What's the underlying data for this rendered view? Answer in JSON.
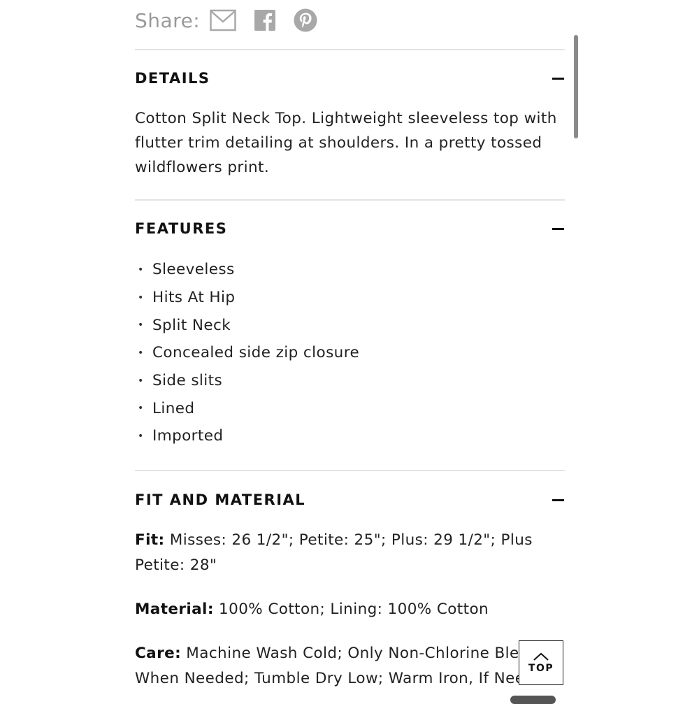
{
  "share": {
    "label": "Share:",
    "icons": [
      "email-icon",
      "facebook-icon",
      "pinterest-icon"
    ]
  },
  "details": {
    "title": "DETAILS",
    "text": "Cotton Split Neck Top. Lightweight sleeveless top with flutter trim detailing at shoulders. In a pretty tossed wildflowers print."
  },
  "features": {
    "title": "FEATURES",
    "items": [
      "Sleeveless",
      "Hits At Hip",
      "Split Neck",
      "Concealed side zip closure",
      "Side slits",
      "Lined",
      "Imported"
    ]
  },
  "fit_material": {
    "title": "FIT AND MATERIAL",
    "fit_label": "Fit:",
    "fit_value": " Misses: 26 1/2\"; Petite: 25\"; Plus: 29 1/2\"; Plus Petite: 28\"",
    "material_label": "Material:",
    "material_value": " 100% Cotton; Lining: 100% Cotton",
    "care_label": "Care:",
    "care_value": " Machine Wash Cold; Only Non-Chlorine Bleach When Needed; Tumble Dry Low; Warm Iron, If Needed"
  },
  "top_button": {
    "label": "TOP"
  },
  "colors": {
    "text": "#222222",
    "muted": "#9a9a9a",
    "divider": "#e3e3e3"
  }
}
